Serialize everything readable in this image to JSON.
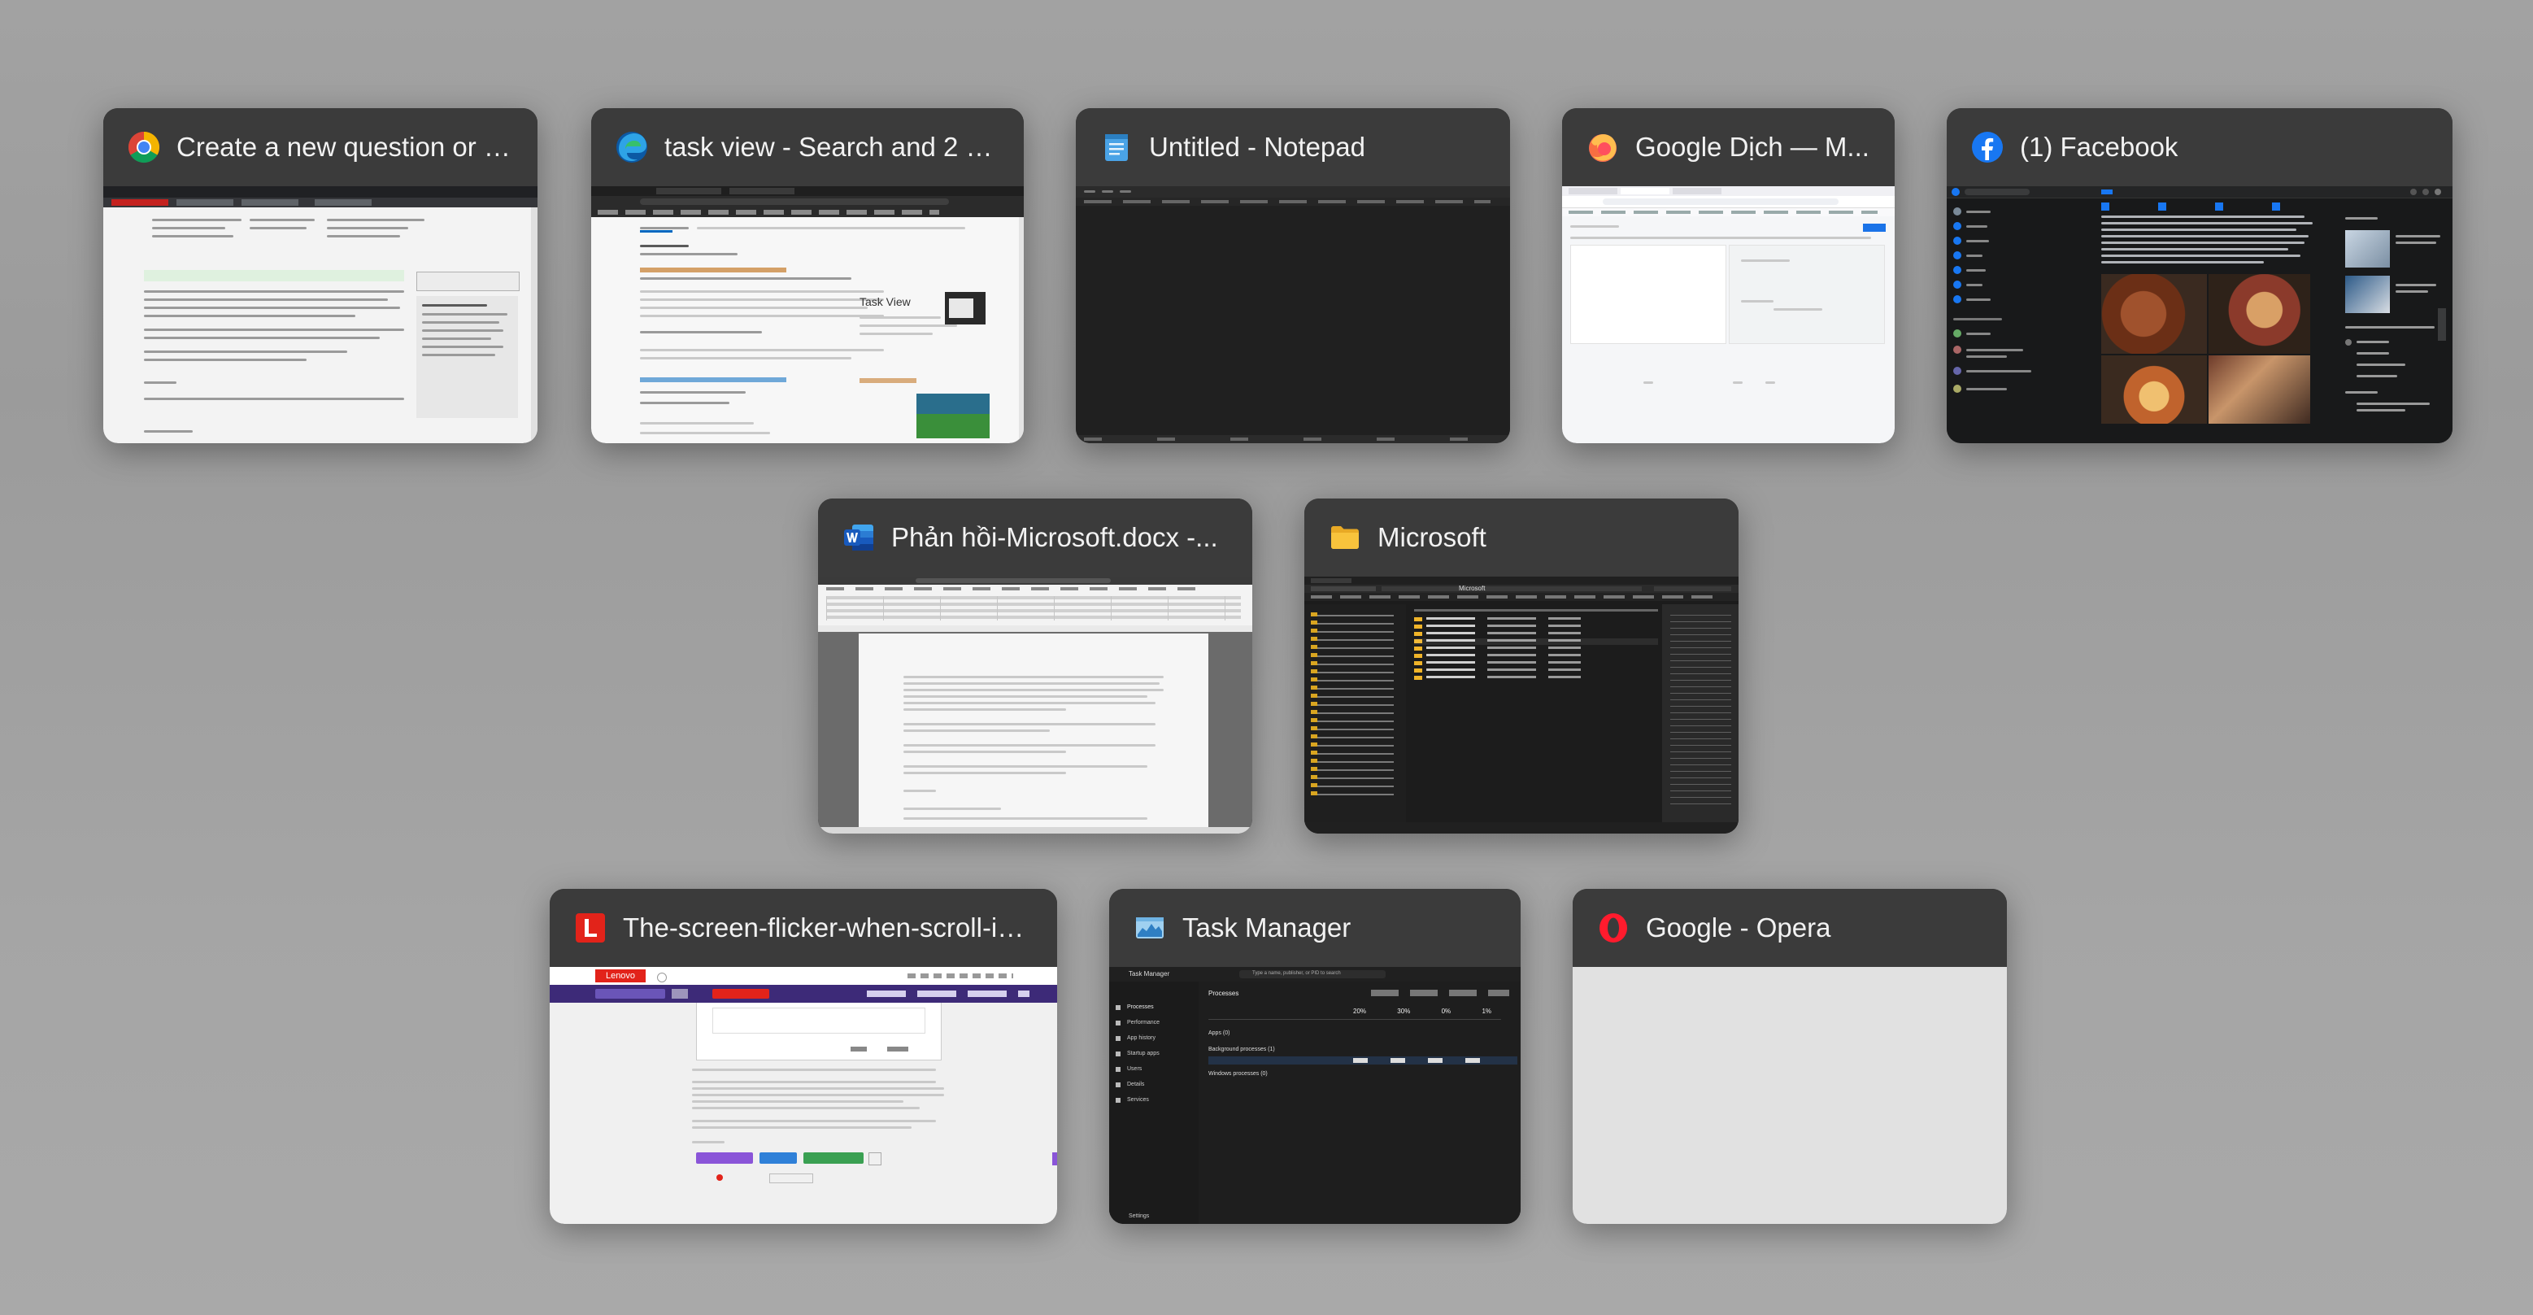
{
  "windows": [
    {
      "title": "Create a new question or st...",
      "icon": "chrome-icon"
    },
    {
      "title": "task view - Search and 2 m...",
      "icon": "edge-icon"
    },
    {
      "title": "Untitled - Notepad",
      "icon": "notepad-icon"
    },
    {
      "title": "Google Dịch — M...",
      "icon": "firefox-icon"
    },
    {
      "title": "(1) Facebook",
      "icon": "facebook-icon"
    },
    {
      "title": "Phản hồi-Microsoft.docx -...",
      "icon": "word-icon"
    },
    {
      "title": "Microsoft",
      "icon": "folder-icon"
    },
    {
      "title": "The-screen-flicker-when-scroll-in-...",
      "icon": "lenovo-icon"
    },
    {
      "title": "Task Manager",
      "icon": "task-manager-icon"
    },
    {
      "title": "Google - Opera",
      "icon": "opera-icon"
    }
  ],
  "previews": {
    "edge_task_view_heading": "Task View",
    "lenovo_brand": "Lenovo",
    "task_manager_title": "Task Manager",
    "task_manager_search": "Type a name, publisher, or PID to search",
    "task_manager_section": "Processes",
    "task_manager_nav": [
      "Processes",
      "Performance",
      "App history",
      "Startup apps",
      "Users",
      "Details",
      "Services"
    ],
    "task_manager_settings": "Settings",
    "task_manager_groups": [
      "Apps (0)",
      "Background processes (1)",
      "Windows processes (0)"
    ],
    "task_manager_stats": [
      "20%",
      "30%",
      "0%",
      "1%"
    ],
    "file_explorer_path": "Microsoft"
  },
  "colors": {
    "backdrop": "#a2a2a2",
    "card_header": "#3b3b3b",
    "card_title_text": "#f2f2f2",
    "lenovo_red": "#e2231a",
    "lenovo_nav": "#3d2a78",
    "opera_red": "#ff1b2d",
    "word_blue": "#185abd",
    "facebook_blue": "#1877f2",
    "folder_yellow": "#f8c33c"
  }
}
